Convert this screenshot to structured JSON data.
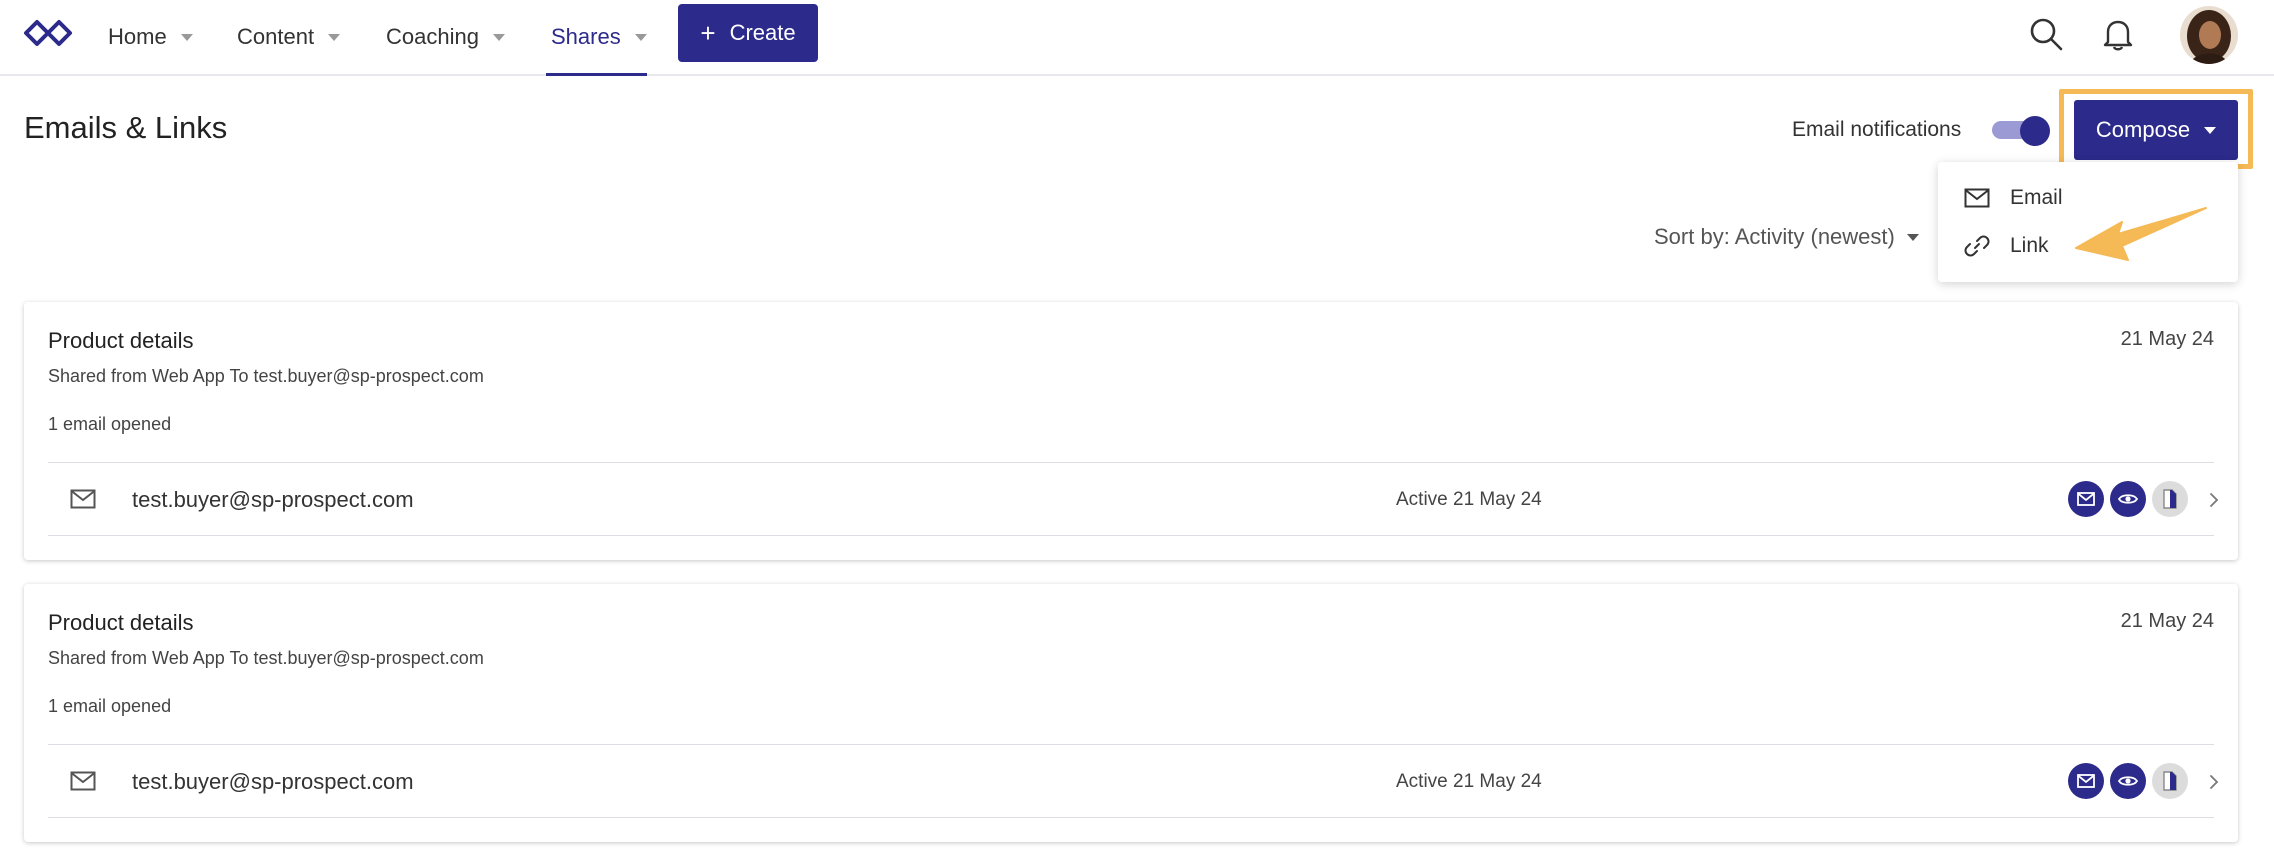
{
  "nav": {
    "items": [
      {
        "label": "Home"
      },
      {
        "label": "Content"
      },
      {
        "label": "Coaching"
      },
      {
        "label": "Shares"
      }
    ],
    "create_label": "Create"
  },
  "header": {
    "title": "Emails & Links",
    "notifications_label": "Email notifications",
    "notifications_on": true,
    "compose_label": "Compose"
  },
  "compose_menu": {
    "items": [
      {
        "label": "Email",
        "icon": "mail-icon"
      },
      {
        "label": "Link",
        "icon": "link-icon"
      }
    ]
  },
  "sort": {
    "label": "Sort by: Activity (newest)"
  },
  "shares": [
    {
      "title": "Product details",
      "date": "21 May 24",
      "subtitle": "Shared from Web App To test.buyer@sp-prospect.com",
      "opened": "1 email opened",
      "recipient": {
        "email": "test.buyer@sp-prospect.com",
        "activity": "Active 21 May 24"
      }
    },
    {
      "title": "Product details",
      "date": "21 May 24",
      "subtitle": "Shared from Web App To test.buyer@sp-prospect.com",
      "opened": "1 email opened",
      "recipient": {
        "email": "test.buyer@sp-prospect.com",
        "activity": "Active 21 May 24"
      }
    }
  ],
  "colors": {
    "brand": "#2c2a8a",
    "highlight": "#f5b955",
    "toggle_track": "#9b9ad4"
  }
}
